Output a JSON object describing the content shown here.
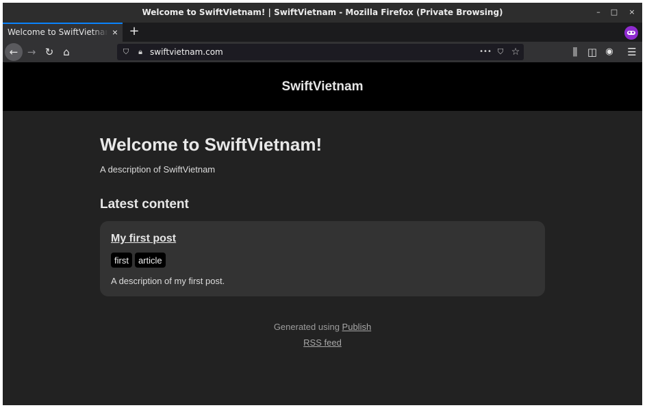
{
  "window": {
    "title": "Welcome to SwiftVietnam! | SwiftVietnam - Mozilla Firefox (Private Browsing)",
    "controls": {
      "minimize": "–",
      "maximize": "□",
      "close": "×"
    }
  },
  "tabs": [
    {
      "label": "Welcome to SwiftVietnam! | SwiftVietnam",
      "close": "×",
      "active": true
    }
  ],
  "tabstrip": {
    "new_tab": "+",
    "private_icon": "private-browsing-mask-icon"
  },
  "toolbar": {
    "back": "←",
    "forward": "→",
    "reload": "↻",
    "home": "⌂",
    "url": "swiftvietnam.com",
    "shield": "⛉",
    "lock": "🔒︎",
    "page_actions": "•••",
    "pocket": "⛉",
    "bookmark": "☆",
    "library": "⫼",
    "sidebar": "◫",
    "account": "◉",
    "menu": "☰"
  },
  "site": {
    "name": "SwiftVietnam",
    "heading": "Welcome to SwiftVietnam!",
    "description": "A description of SwiftVietnam",
    "latest_title": "Latest content",
    "posts": [
      {
        "title": "My first post",
        "tags": [
          "first",
          "article"
        ],
        "description": "A description of my first post."
      }
    ],
    "footer": {
      "generated_prefix": "Generated using ",
      "generated_link": "Publish",
      "rss": "RSS feed"
    }
  },
  "colors": {
    "page_bg": "#222222",
    "header_bg": "#000000",
    "card_bg": "#333333",
    "tab_accent": "#0a84ff",
    "private_purple": "#8f2bd0"
  }
}
